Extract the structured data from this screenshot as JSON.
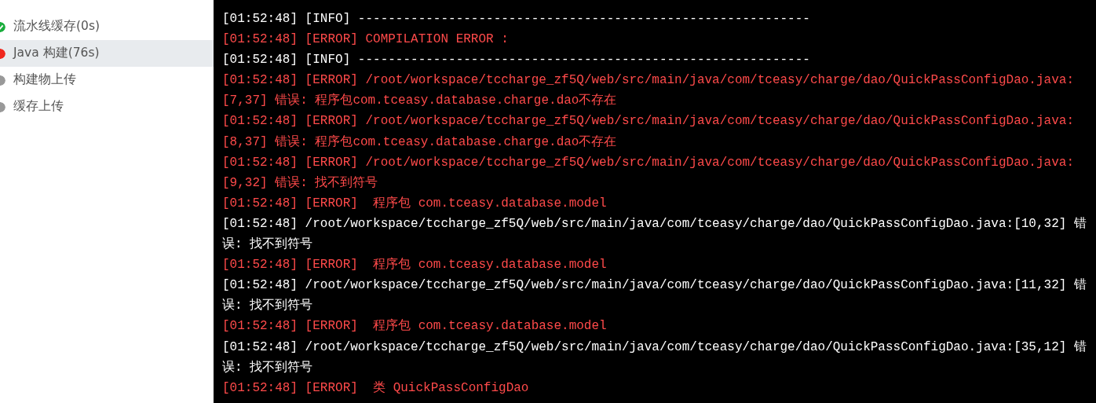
{
  "stages": [
    {
      "label": "流水线缓存(0s)",
      "kind": "check",
      "color": "#1aad3c",
      "selected": false
    },
    {
      "label": "Java 构建(76s)",
      "kind": "dot",
      "color": "#f0281e",
      "selected": true
    },
    {
      "label": "构建物上传",
      "kind": "dot",
      "color": "#999999",
      "selected": false
    },
    {
      "label": "缓存上传",
      "kind": "dot",
      "color": "#999999",
      "selected": false
    }
  ],
  "log": [
    {
      "kind": "info",
      "text": "[01:52:48] [INFO] ------------------------------------------------------------"
    },
    {
      "kind": "error",
      "text": "[01:52:48] [ERROR] COMPILATION ERROR :"
    },
    {
      "kind": "info",
      "text": "[01:52:48] [INFO] ------------------------------------------------------------"
    },
    {
      "kind": "error",
      "text": "[01:52:48] [ERROR] /root/workspace/tccharge_zf5Q/web/src/main/java/com/tceasy/charge/dao/QuickPassConfigDao.java:[7,37] 错误: 程序包com.tceasy.database.charge.dao不存在"
    },
    {
      "kind": "error",
      "text": "[01:52:48] [ERROR] /root/workspace/tccharge_zf5Q/web/src/main/java/com/tceasy/charge/dao/QuickPassConfigDao.java:[8,37] 错误: 程序包com.tceasy.database.charge.dao不存在"
    },
    {
      "kind": "error",
      "text": "[01:52:48] [ERROR] /root/workspace/tccharge_zf5Q/web/src/main/java/com/tceasy/charge/dao/QuickPassConfigDao.java:[9,32] 错误: 找不到符号"
    },
    {
      "kind": "error",
      "text": "[01:52:48] [ERROR]  程序包 com.tceasy.database.model"
    },
    {
      "kind": "info",
      "text": "[01:52:48] /root/workspace/tccharge_zf5Q/web/src/main/java/com/tceasy/charge/dao/QuickPassConfigDao.java:[10,32] 错误: 找不到符号"
    },
    {
      "kind": "error",
      "text": "[01:52:48] [ERROR]  程序包 com.tceasy.database.model"
    },
    {
      "kind": "info",
      "text": "[01:52:48] /root/workspace/tccharge_zf5Q/web/src/main/java/com/tceasy/charge/dao/QuickPassConfigDao.java:[11,32] 错误: 找不到符号"
    },
    {
      "kind": "error",
      "text": "[01:52:48] [ERROR]  程序包 com.tceasy.database.model"
    },
    {
      "kind": "info",
      "text": "[01:52:48] /root/workspace/tccharge_zf5Q/web/src/main/java/com/tceasy/charge/dao/QuickPassConfigDao.java:[35,12] 错误: 找不到符号"
    },
    {
      "kind": "error",
      "text": "[01:52:48] [ERROR]  类 QuickPassConfigDao"
    }
  ]
}
